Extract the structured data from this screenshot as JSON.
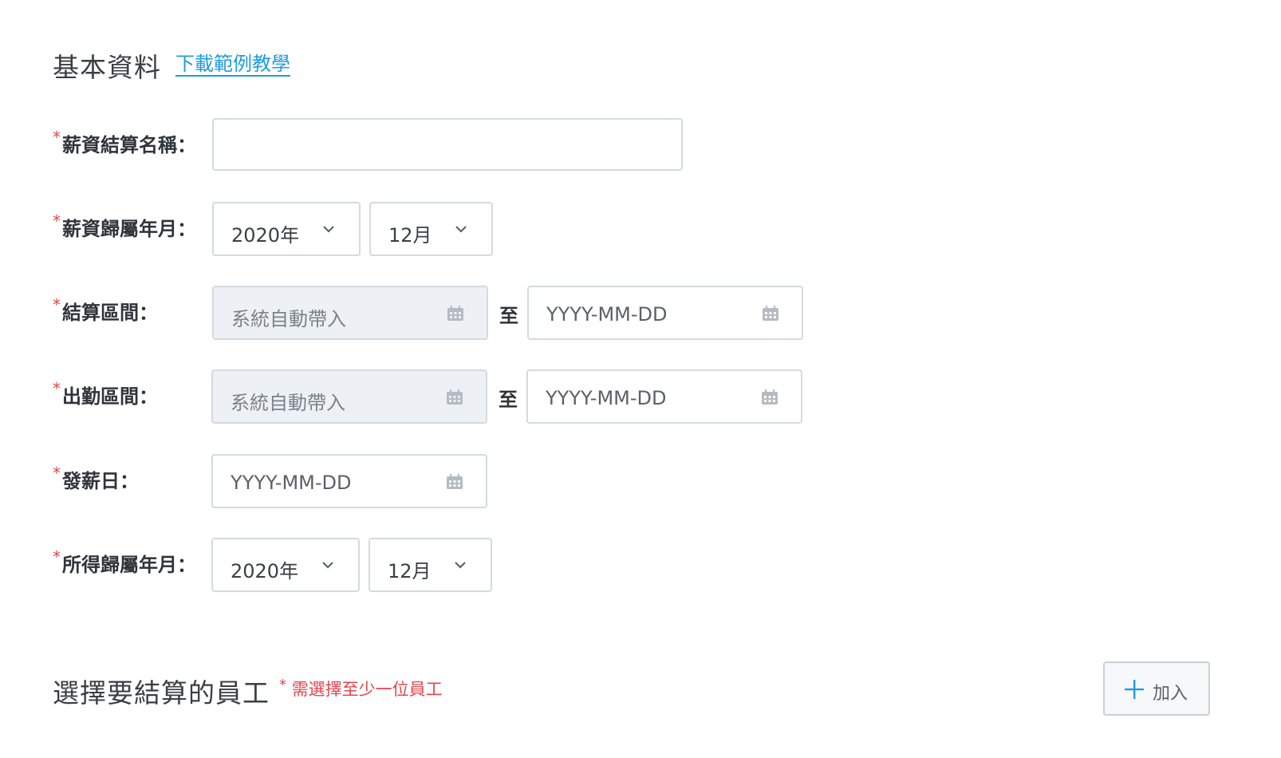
{
  "basic_info": {
    "title": "基本資料",
    "tutorial_link": "下載範例教學"
  },
  "form": {
    "required_mark": "*",
    "salary_name": {
      "label": "薪資結算名稱：",
      "value": "",
      "placeholder": ""
    },
    "salary_month": {
      "label": "薪資歸屬年月：",
      "year": "2020年",
      "month": "12月"
    },
    "settlement_range": {
      "label": "結算區間：",
      "start": "系統自動帶入",
      "separator": "至",
      "end": "YYYY-MM-DD"
    },
    "attendance_range": {
      "label": "出勤區間：",
      "start": "系統自動帶入",
      "separator": "至",
      "end": "YYYY-MM-DD"
    },
    "pay_day": {
      "label": "發薪日：",
      "value": "YYYY-MM-DD"
    },
    "income_month": {
      "label": "所得歸屬年月：",
      "year": "2020年",
      "month": "12月"
    }
  },
  "employee_section": {
    "title": "選擇要結算的員工",
    "note": "需選擇至少一位員工",
    "add_button_label": "加入"
  },
  "colors": {
    "link": "#1f9be0",
    "required": "#e0464c",
    "border": "#d5dae0",
    "disabled_bg": "#edf1f5"
  },
  "icons": {
    "calendar": "calendar-icon",
    "chevron": "chevron-down-icon",
    "plus": "plus-icon"
  }
}
